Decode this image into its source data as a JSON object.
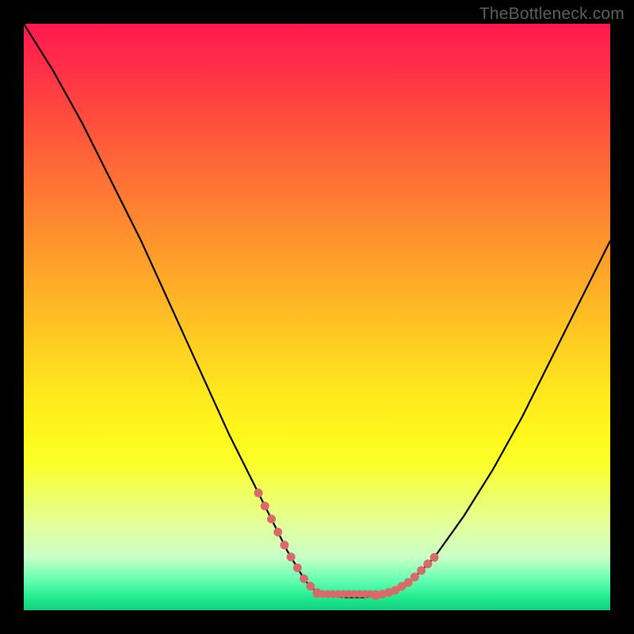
{
  "watermark": "TheBottleneck.com",
  "chart_data": {
    "type": "line",
    "title": "",
    "xlabel": "",
    "ylabel": "",
    "xlim": [
      0,
      100
    ],
    "ylim": [
      0,
      100
    ],
    "series": [
      {
        "name": "curve",
        "x": [
          0,
          5,
          10,
          15,
          20,
          25,
          30,
          35,
          40,
          45,
          48,
          50,
          52,
          55,
          58,
          60,
          63,
          66,
          70,
          75,
          80,
          85,
          90,
          95,
          100
        ],
        "y": [
          100,
          92,
          83,
          73,
          63,
          52,
          41,
          30,
          20,
          10,
          5,
          3,
          2.5,
          2.2,
          2.2,
          2.5,
          3.2,
          5,
          9,
          16,
          24,
          33,
          43,
          53,
          63
        ]
      }
    ],
    "highlight_segments": [
      {
        "name": "left-dotted",
        "x_range": [
          40,
          50
        ]
      },
      {
        "name": "right-dotted",
        "x_range": [
          60,
          70
        ]
      }
    ],
    "flat_dotted_range": [
      50,
      60
    ],
    "colors": {
      "curve": "#000000",
      "dots": "#d86a6a",
      "flat_line": "#d86a6a"
    }
  }
}
